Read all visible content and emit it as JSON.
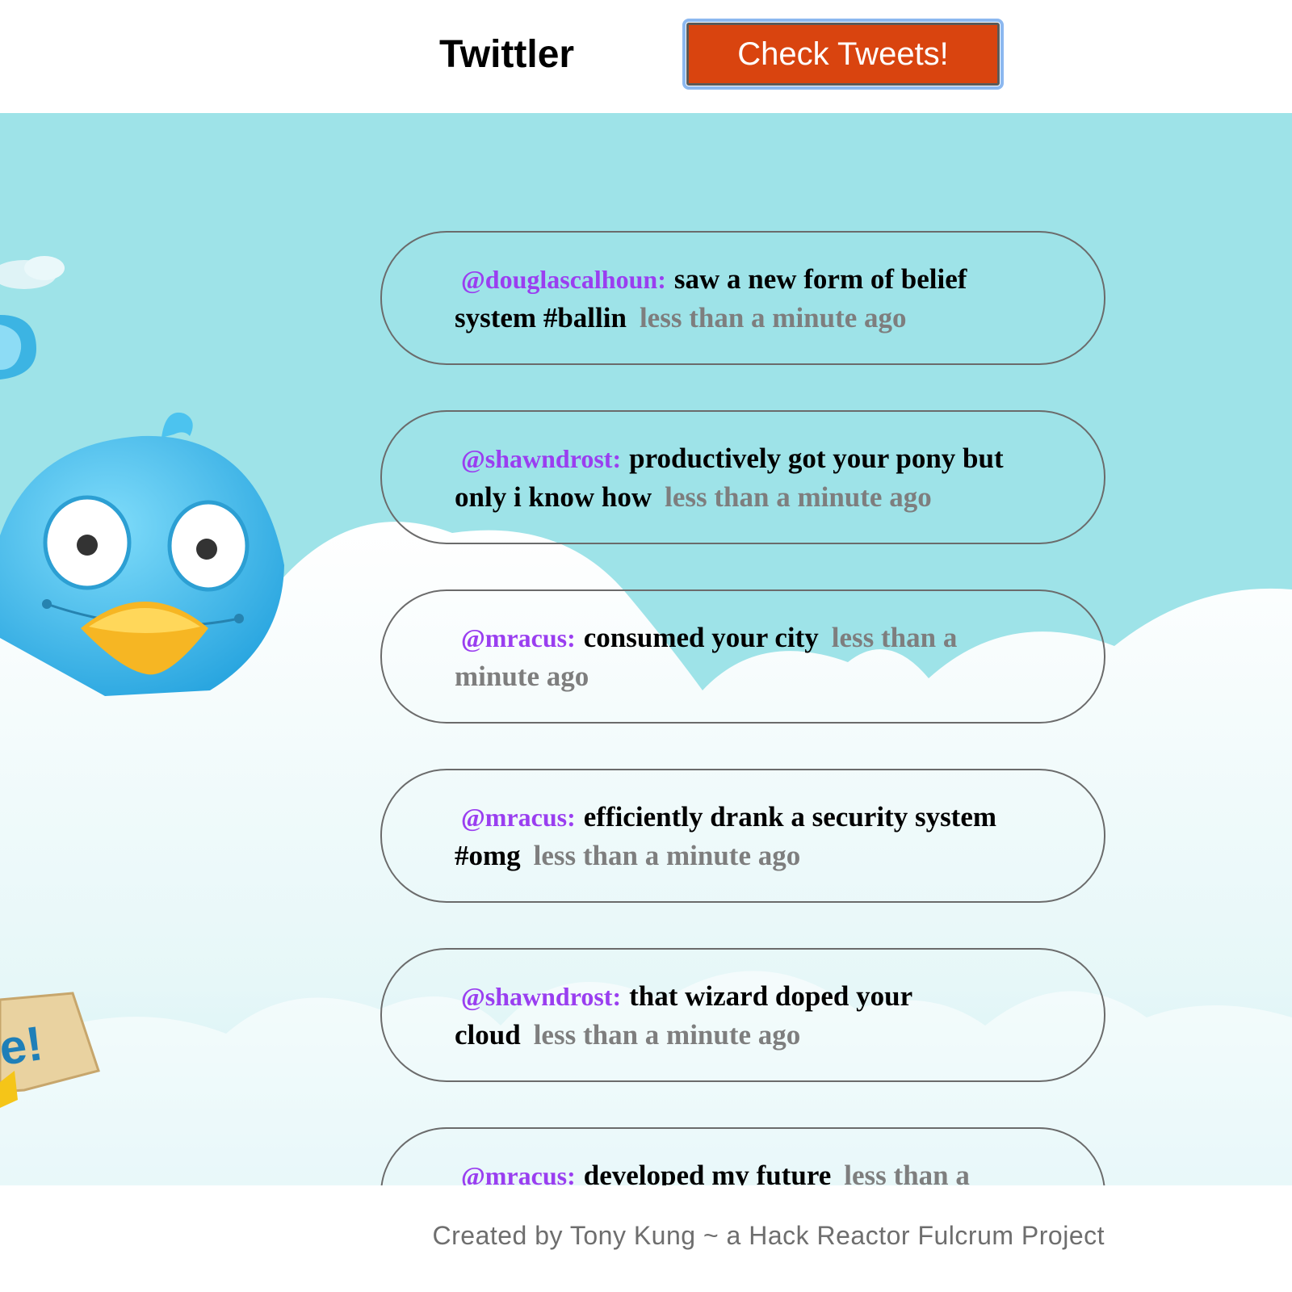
{
  "header": {
    "title": "Twittler",
    "check_button_label": "Check Tweets!"
  },
  "background": {
    "banner_text": "e!"
  },
  "tweets": [
    {
      "handle": "@douglascalhoun:",
      "text": "saw a new form of belief system #ballin",
      "time": "less than a minute ago"
    },
    {
      "handle": "@shawndrost:",
      "text": "productively got your pony but only i know how",
      "time": "less than a minute ago"
    },
    {
      "handle": "@mracus:",
      "text": "consumed your city",
      "time": "less than a minute ago"
    },
    {
      "handle": "@mracus:",
      "text": "efficiently drank a security system #omg",
      "time": "less than a minute ago"
    },
    {
      "handle": "@shawndrost:",
      "text": "that wizard doped your cloud",
      "time": "less than a minute ago"
    },
    {
      "handle": "@mracus:",
      "text": "developed my future",
      "time": "less than a minute ago"
    }
  ],
  "footer": {
    "credit": "Created by Tony Kung ~ a Hack Reactor Fulcrum Project"
  },
  "colors": {
    "button": "#d9440f",
    "sky": "#9ee3e8",
    "handle": "#9a3ef0",
    "timestamp": "#7e7e7e"
  }
}
